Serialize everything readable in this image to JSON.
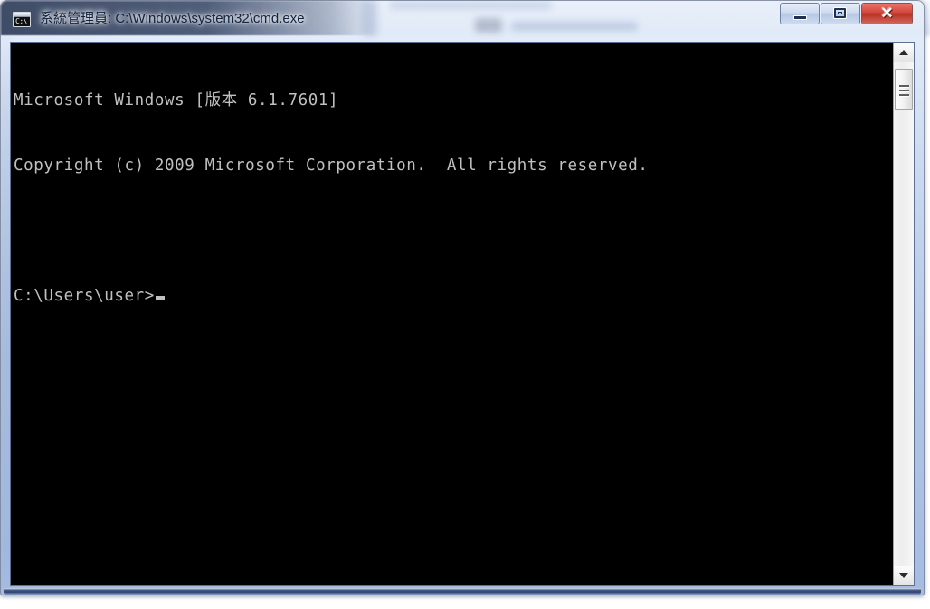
{
  "window": {
    "title": "系統管理員: C:\\Windows\\system32\\cmd.exe",
    "icon_name": "cmd-console-icon",
    "icon_glyph": "C:\\",
    "controls": {
      "minimize_label": "Minimize",
      "restore_label": "Restore",
      "close_label": "Close",
      "close_glyph": "✕"
    },
    "frame_color": "#b4c6e4",
    "accent_color": "#2b3c63"
  },
  "console": {
    "background_color": "#000000",
    "text_color": "#c0c0c0",
    "lines": [
      "Microsoft Windows [版本 6.1.7601]",
      "Copyright (c) 2009 Microsoft Corporation.  All rights reserved.",
      "",
      "C:\\Users\\user>"
    ],
    "prompt": "C:\\Users\\user>",
    "cursor_visible": true
  },
  "scrollbar": {
    "up_arrow_label": "Scroll up",
    "down_arrow_label": "Scroll down",
    "thumb_label": "Scroll thumb"
  }
}
